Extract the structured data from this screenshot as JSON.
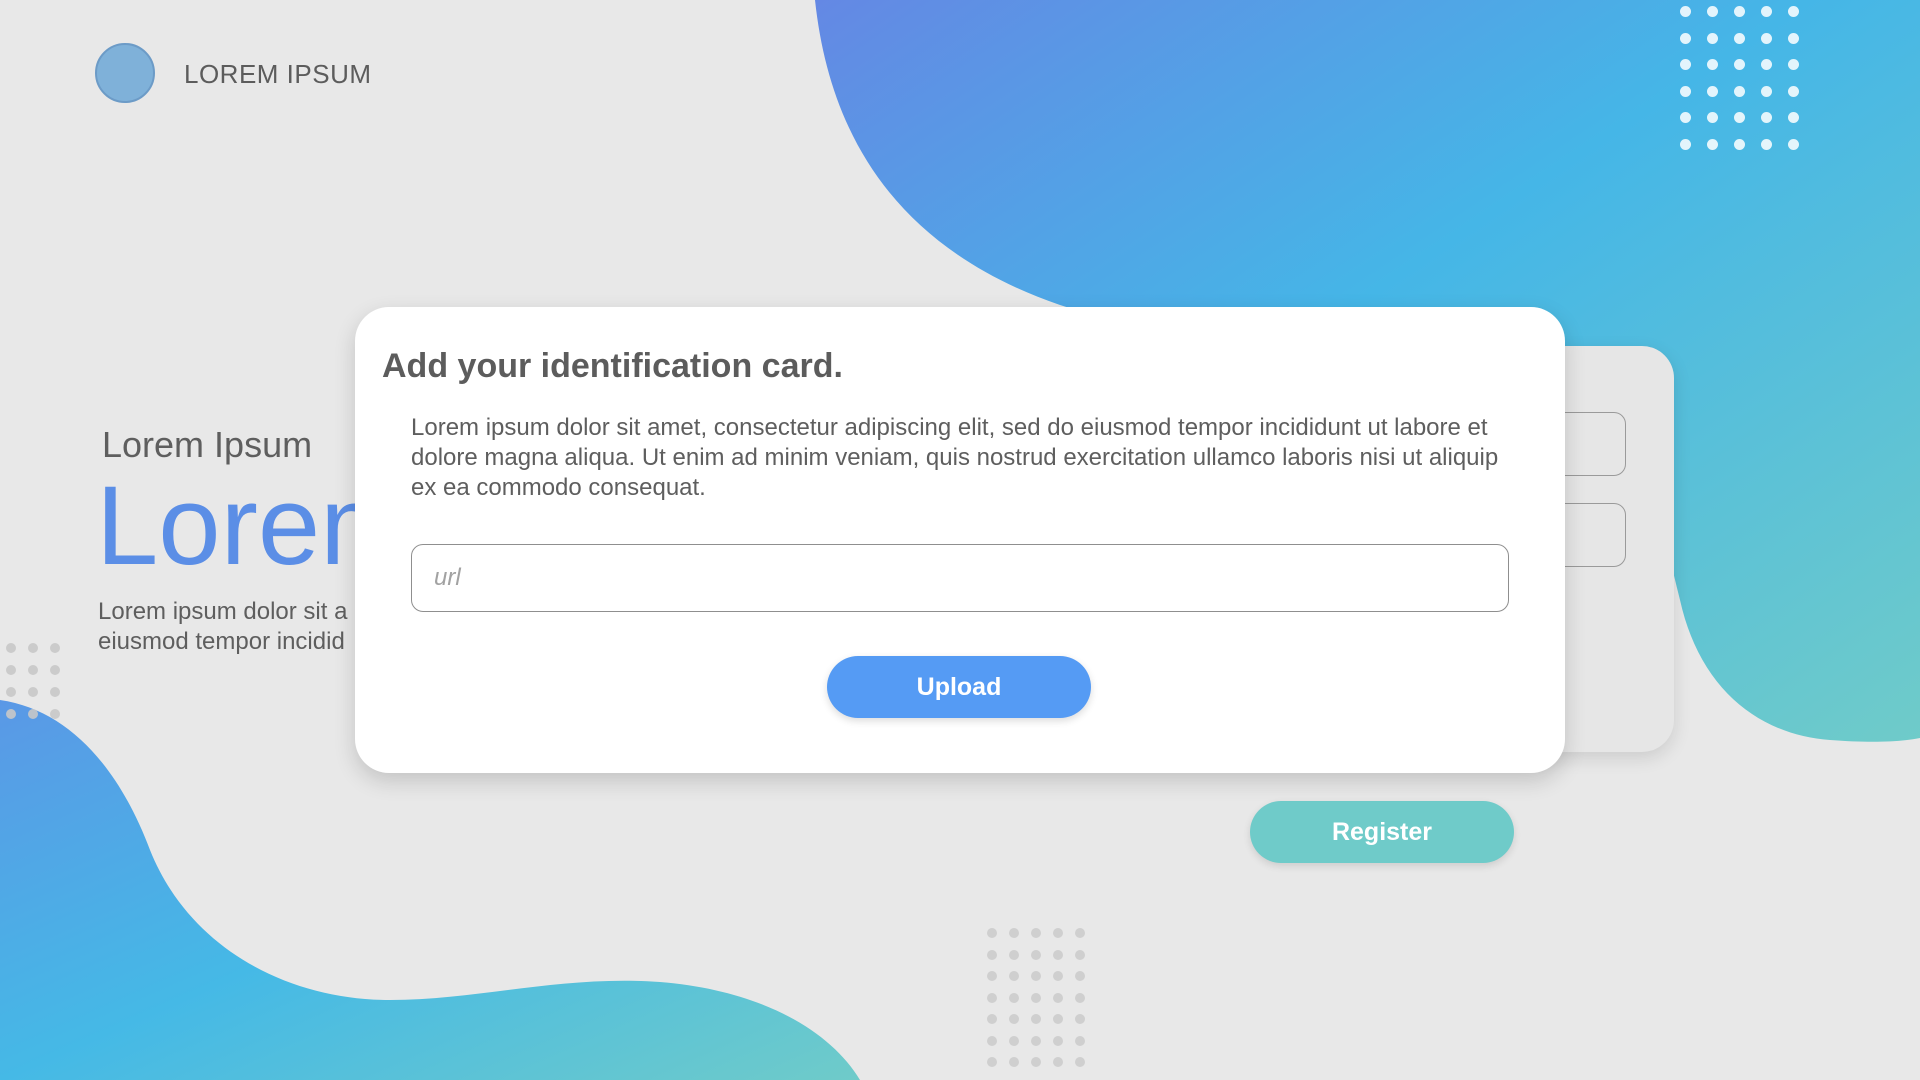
{
  "brand": {
    "name": "LOREM IPSUM",
    "logo_color": "#7fb1d9"
  },
  "hero": {
    "subtitle": "Lorem Ipsum",
    "title": "Lorem",
    "paragraph_lines": [
      "Lorem ipsum dolor sit a",
      "eiusmod tempor incidid"
    ]
  },
  "register": {
    "button_label": "Register",
    "button_color": "#6fcbc9"
  },
  "modal": {
    "title": "Add your identification card.",
    "description": "Lorem ipsum dolor sit amet, consectetur adipiscing elit, sed do eiusmod tempor incididunt ut labore et dolore magna aliqua. Ut enim ad minim veniam, quis nostrud exercitation ullamco laboris nisi ut aliquip ex ea commodo consequat.",
    "url_input": {
      "placeholder": "url",
      "value": ""
    },
    "upload_label": "Upload",
    "upload_color": "#559bf4"
  },
  "theme": {
    "background": "#e8e8e8",
    "gradient_start": "#5b8ee6",
    "gradient_mid": "#45b8e6",
    "gradient_end": "#6fcbc9"
  }
}
